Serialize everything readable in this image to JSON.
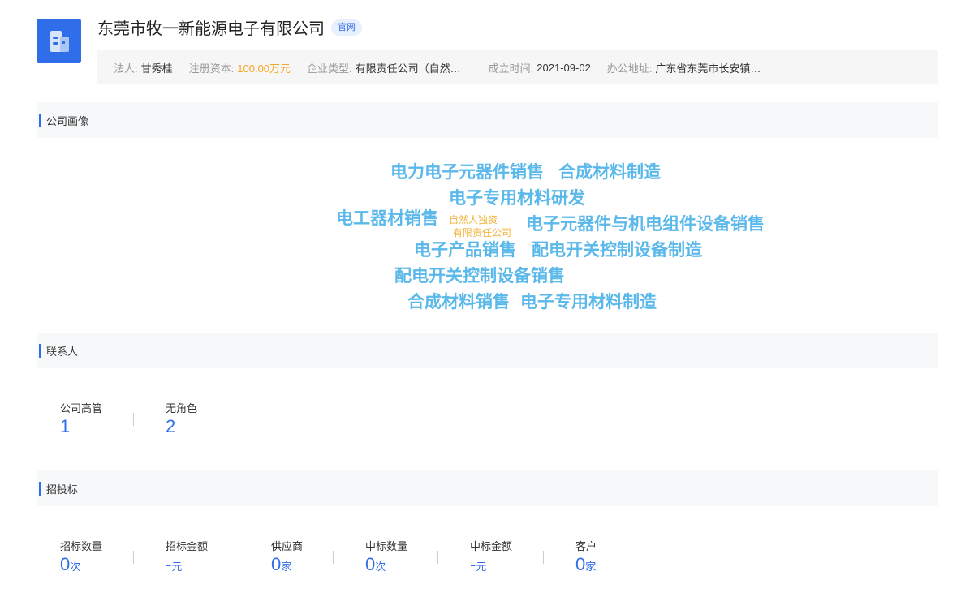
{
  "company": {
    "name": "东莞市牧一新能源电子有限公司",
    "badge": "官网"
  },
  "info": [
    {
      "label": "法人:",
      "value": "甘秀桂"
    },
    {
      "label": "注册资本:",
      "value": "100.00万元",
      "highlight": "#f5a623"
    },
    {
      "label": "企业类型:",
      "value": "有限责任公司（自然…"
    },
    {
      "label": "成立时间:",
      "value": "2021-09-02"
    },
    {
      "label": "办公地址:",
      "value": "广东省东莞市长安镇…"
    }
  ],
  "sections": {
    "profile": "公司画像",
    "contacts": "联系人",
    "bidding": "招投标"
  },
  "word_cloud": [
    "电力电子元器件销售",
    "合成材料制造",
    "电子专用材料研发",
    "电工器材销售",
    "自然人独资",
    "有限责任公司",
    "电子元器件与机电组件设备销售",
    "电子产品销售",
    "配电开关控制设备制造",
    "配电开关控制设备销售",
    "合成材料销售",
    "电子专用材料制造"
  ],
  "contacts": [
    {
      "label": "公司高管",
      "value": "1"
    },
    {
      "label": "无角色",
      "value": "2"
    }
  ],
  "bidding": [
    {
      "label": "招标数量",
      "value": "0",
      "unit": "次"
    },
    {
      "label": "招标金额",
      "value": "-",
      "unit": "元"
    },
    {
      "label": "供应商",
      "value": "0",
      "unit": "家"
    },
    {
      "label": "中标数量",
      "value": "0",
      "unit": "次"
    },
    {
      "label": "中标金额",
      "value": "-",
      "unit": "元"
    },
    {
      "label": "客户",
      "value": "0",
      "unit": "家"
    }
  ],
  "colors": {
    "accent": "#2f6ee8",
    "cloud_primary": "#5bb8ea",
    "cloud_secondary": "#f2b43c",
    "money": "#f5a623"
  },
  "icons": {
    "logo": "building-icon"
  }
}
